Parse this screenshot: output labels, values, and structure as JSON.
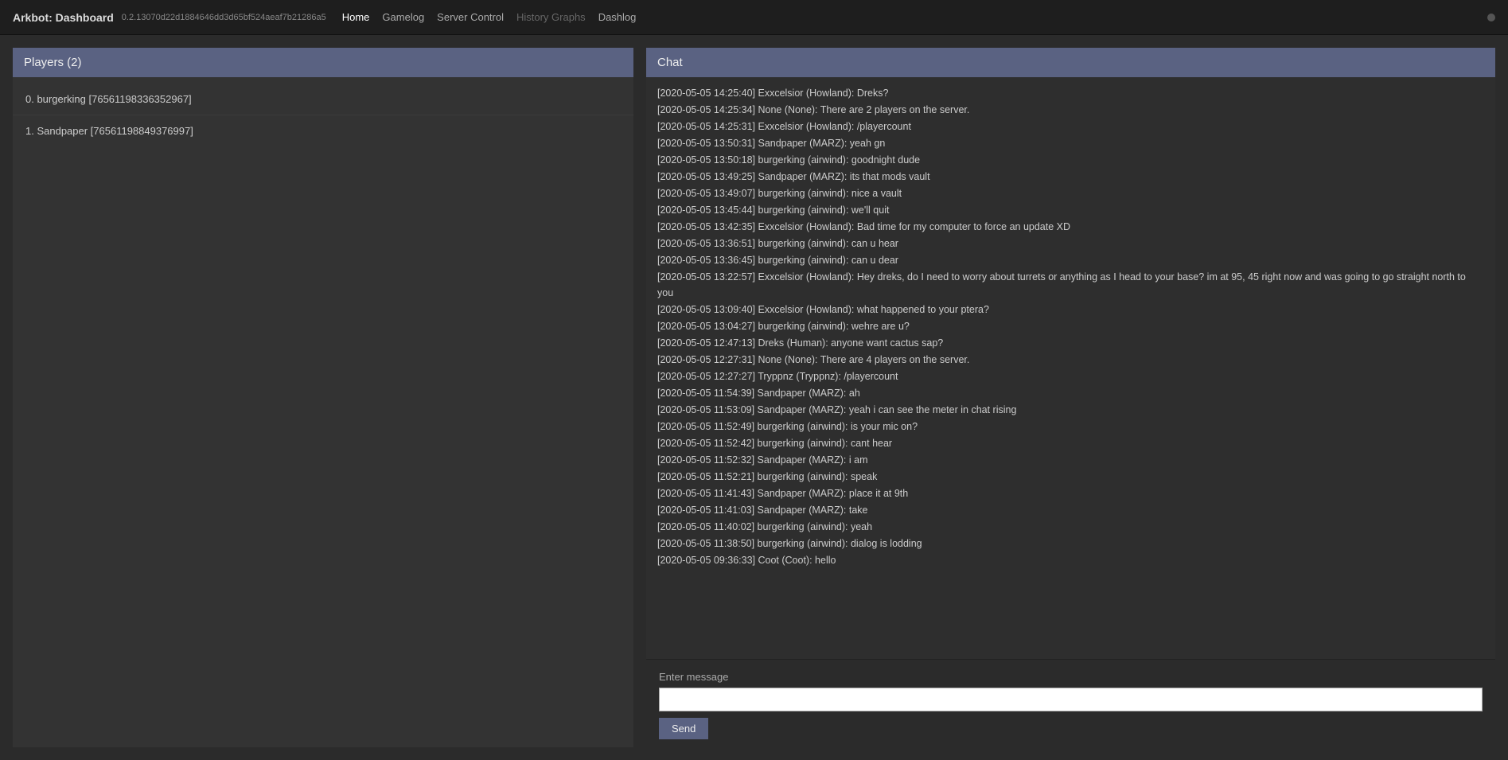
{
  "header": {
    "title": "Arkbot: Dashboard",
    "version": "0.2.13070d22d1884646dd3d65bf524aeaf7b21286a5",
    "nav": [
      {
        "label": "Home",
        "state": "active"
      },
      {
        "label": "Gamelog",
        "state": "normal"
      },
      {
        "label": "Server Control",
        "state": "normal"
      },
      {
        "label": "History Graphs",
        "state": "disabled"
      },
      {
        "label": "Dashlog",
        "state": "normal"
      }
    ]
  },
  "players": {
    "panel_title": "Players (2)",
    "items": [
      {
        "text": "0. burgerking [76561198336352967]"
      },
      {
        "text": "1. Sandpaper [76561198849376997]"
      }
    ]
  },
  "chat": {
    "panel_title": "Chat",
    "messages": [
      {
        "line": "[2020-05-05 14:25:40] Exxcelsior (Howland): Dreks?"
      },
      {
        "line": "[2020-05-05 14:25:34] None (None): There are 2 players on the server."
      },
      {
        "line": "[2020-05-05 14:25:31] Exxcelsior (Howland): /playercount"
      },
      {
        "line": "[2020-05-05 13:50:31] Sandpaper (MARZ): yeah gn"
      },
      {
        "line": "[2020-05-05 13:50:18] burgerking (airwind): goodnight dude"
      },
      {
        "line": "[2020-05-05 13:49:25] Sandpaper (MARZ): its that mods vault"
      },
      {
        "line": "[2020-05-05 13:49:07] burgerking (airwind): nice a vault"
      },
      {
        "line": "[2020-05-05 13:45:44] burgerking (airwind): we'll quit"
      },
      {
        "line": "[2020-05-05 13:42:35] Exxcelsior (Howland): Bad time for my computer to force an update XD"
      },
      {
        "line": "[2020-05-05 13:36:51] burgerking (airwind): can u hear"
      },
      {
        "line": "[2020-05-05 13:36:45] burgerking (airwind): can u dear"
      },
      {
        "line": "[2020-05-05 13:22:57] Exxcelsior (Howland): Hey dreks, do I need to worry about turrets or anything as I head to your base? im at 95, 45 right now and was going to go straight north to you"
      },
      {
        "line": "[2020-05-05 13:09:40] Exxcelsior (Howland): what happened to your ptera?"
      },
      {
        "line": "[2020-05-05 13:04:27] burgerking (airwind): wehre are u?"
      },
      {
        "line": "[2020-05-05 12:47:13] Dreks (Human): anyone want cactus sap?"
      },
      {
        "line": "[2020-05-05 12:27:31] None (None): There are 4 players on the server."
      },
      {
        "line": "[2020-05-05 12:27:27] Tryppnz (Tryppnz): /playercount"
      },
      {
        "line": "[2020-05-05 11:54:39] Sandpaper (MARZ): ah"
      },
      {
        "line": "[2020-05-05 11:53:09] Sandpaper (MARZ): yeah i can see the meter in chat rising"
      },
      {
        "line": "[2020-05-05 11:52:49] burgerking (airwind): is your mic on?"
      },
      {
        "line": "[2020-05-05 11:52:42] burgerking (airwind): cant hear"
      },
      {
        "line": "[2020-05-05 11:52:32] Sandpaper (MARZ): i am"
      },
      {
        "line": "[2020-05-05 11:52:21] burgerking (airwind): speak"
      },
      {
        "line": "[2020-05-05 11:41:43] Sandpaper (MARZ): place it at 9th"
      },
      {
        "line": "[2020-05-05 11:41:03] Sandpaper (MARZ): take"
      },
      {
        "line": "[2020-05-05 11:40:02] burgerking (airwind): yeah"
      },
      {
        "line": "[2020-05-05 11:38:50] burgerking (airwind): dialog is lodding"
      },
      {
        "line": "[2020-05-05 09:36:33] Coot (Coot): hello"
      }
    ],
    "input_label": "Enter message",
    "input_placeholder": "",
    "send_label": "Send"
  }
}
